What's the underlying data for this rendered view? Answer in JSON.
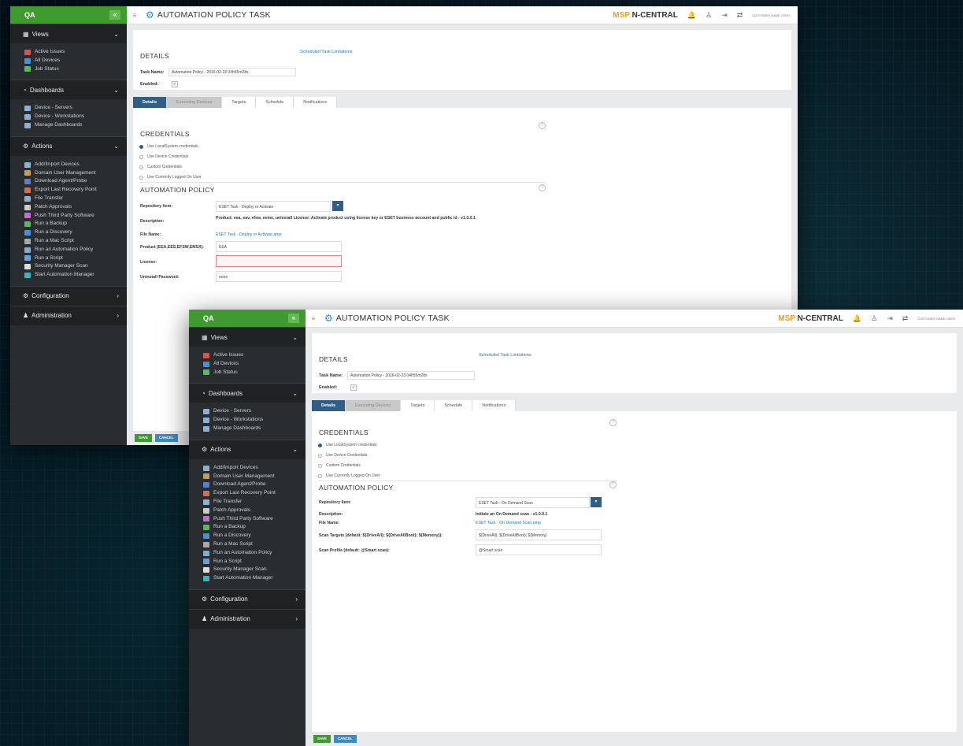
{
  "colors": {
    "accent_green": "#3f9a30",
    "tab_active": "#2f5f86",
    "link": "#2478b4",
    "brand_orange": "#f29a1f"
  },
  "sidebar": {
    "customer": "QA",
    "views": {
      "label": "Views",
      "items": [
        "Active Issues",
        "All Devices",
        "Job Status"
      ]
    },
    "dashboards": {
      "label": "Dashboards",
      "items": [
        "Device - Servers",
        "Device - Workstations",
        "Manage Dashboards"
      ]
    },
    "actions": {
      "label": "Actions",
      "items": [
        "Add/Import Devices",
        "Domain User Management",
        "Download Agent/Probe",
        "Export Last Recovery Point",
        "File Transfer",
        "Patch Approvals",
        "Push Third Party Software",
        "Run a Backup",
        "Run a Discovery",
        "Run a Mac Script",
        "Run an Automation Policy",
        "Run a Script",
        "Security Manager Scan",
        "Start Automation Manager"
      ]
    },
    "configuration": "Configuration",
    "administration": "Administration"
  },
  "topbar": {
    "title": "AUTOMATION POLICY TASK",
    "brand_msp": "MSP",
    "brand_name": "N-CENTRAL",
    "user": "CUSTOMER NAME USER"
  },
  "details": {
    "heading": "DETAILS",
    "limitations_link": "Scheduled Task Limitations",
    "task_name_label": "Task Name:",
    "task_name_value": "Automation Policy - 2016-02-23 04h55m28s",
    "enabled_label": "Enabled:"
  },
  "tabs": [
    "Details",
    "Executing Devices",
    "Targets",
    "Schedule",
    "Notifications"
  ],
  "credentials": {
    "heading": "CREDENTIALS",
    "options": [
      "Use LocalSystem credentials",
      "Use Device Credentials",
      "Custom Credentials",
      "Use Currently Logged On User"
    ]
  },
  "policy_heading": "AUTOMATION POLICY",
  "window1": {
    "repository_label": "Repository Item:",
    "repository_value": "ESET Task - Deploy or Activate",
    "description_label": "Description:",
    "description_value": "Product: eea, eav, efsw, eems, uninstall License: Activate product using license key or ESET business account and public id - v1.0.0.1",
    "file_name_label": "File Name:",
    "file_name_value": "ESET Task - Deploy or Activate.amp",
    "product_label": "Product (EEA,EES,EFSW,EMSX):",
    "product_value": "EEA",
    "license_label": "License:",
    "license_value": "",
    "uninstall_label": "Uninstall Password:",
    "uninstall_value": "none"
  },
  "window2": {
    "repository_label": "Repository Item:",
    "repository_value": "ESET Task - On Demand Scan",
    "description_label": "Description:",
    "description_value": "Initiate an On Demand scan - v1.0.0.1",
    "file_name_label": "File Name:",
    "file_name_value": "ESET Task - On Demand Scan.amp",
    "scan_targets_label": "Scan Targets (default: ${DriveAll}; ${DriveAllBoot}; ${Memory}):",
    "scan_targets_value": "${DriveAll}; ${DriveAllBoot}; ${Memory}",
    "scan_profile_label": "Scan Profile (default: @Smart scan):",
    "scan_profile_value": "@Smart scan"
  },
  "footer": {
    "save": "SAVE",
    "cancel": "CANCEL"
  }
}
